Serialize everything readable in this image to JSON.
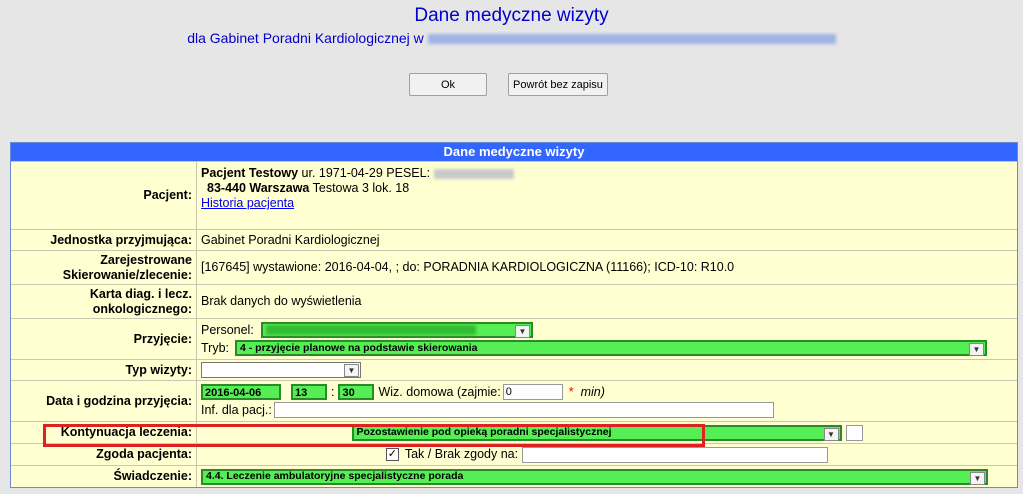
{
  "header": {
    "title": "Dane medyczne wizyty",
    "subtitle_prefix": "dla Gabinet Poradni Kardiologicznej w"
  },
  "buttons": {
    "ok": "Ok",
    "back": "Powrót bez zapisu"
  },
  "form": {
    "heading": "Dane medyczne wizyty",
    "pacjent": {
      "label": "Pacjent:",
      "name": "Pacjent Testowy",
      "birth": "ur. 1971-04-29 PESEL:",
      "city": "83-440 Warszawa",
      "street": "Testowa 3 lok. 18",
      "history_link": "Historia pacjenta"
    },
    "jednostka": {
      "label": "Jednostka przyjmująca:",
      "value": "Gabinet Poradni Kardiologicznej"
    },
    "skierowanie": {
      "label1": "Zarejestrowane",
      "label2": "Skierowanie/zlecenie:",
      "value": "[167645] wystawione: 2016-04-04, ; do: PORADNIA KARDIOLOGICZNA (11166); ICD-10: R10.0"
    },
    "karta": {
      "label1": "Karta diag. i lecz.",
      "label2": "onkologicznego:",
      "value": "Brak danych do wyświetlenia"
    },
    "przyjecie": {
      "label": "Przyjęcie:",
      "personel_label": "Personel:",
      "tryb_label": "Tryb:",
      "tryb_value": "4 - przyjęcie planowe na podstawie skierowania"
    },
    "typ_wizyty": {
      "label": "Typ wizyty:",
      "value": ""
    },
    "data": {
      "label": "Data i godzina przyjęcia:",
      "date": "2016-04-06",
      "hour": "13",
      "sep": ":",
      "minute": "30",
      "home_label": "Wiz. domowa (zajmie:",
      "home_value": "0",
      "required_mark": "*",
      "unit": "min)",
      "info_label": "Inf. dla pacj.:",
      "info_value": ""
    },
    "kontynuacja": {
      "label": "Kontynuacja leczenia:",
      "value": "Pozostawienie pod opieką poradni specjalistycznej"
    },
    "zgoda": {
      "label": "Zgoda pacjenta:",
      "checkbox_label": "Tak / Brak zgody na:",
      "checked": "✓",
      "value": ""
    },
    "swiadczenie": {
      "label": "Świadczenie:",
      "value": "4.4. Leczenie ambulatoryjne specjalistyczne porada"
    }
  }
}
